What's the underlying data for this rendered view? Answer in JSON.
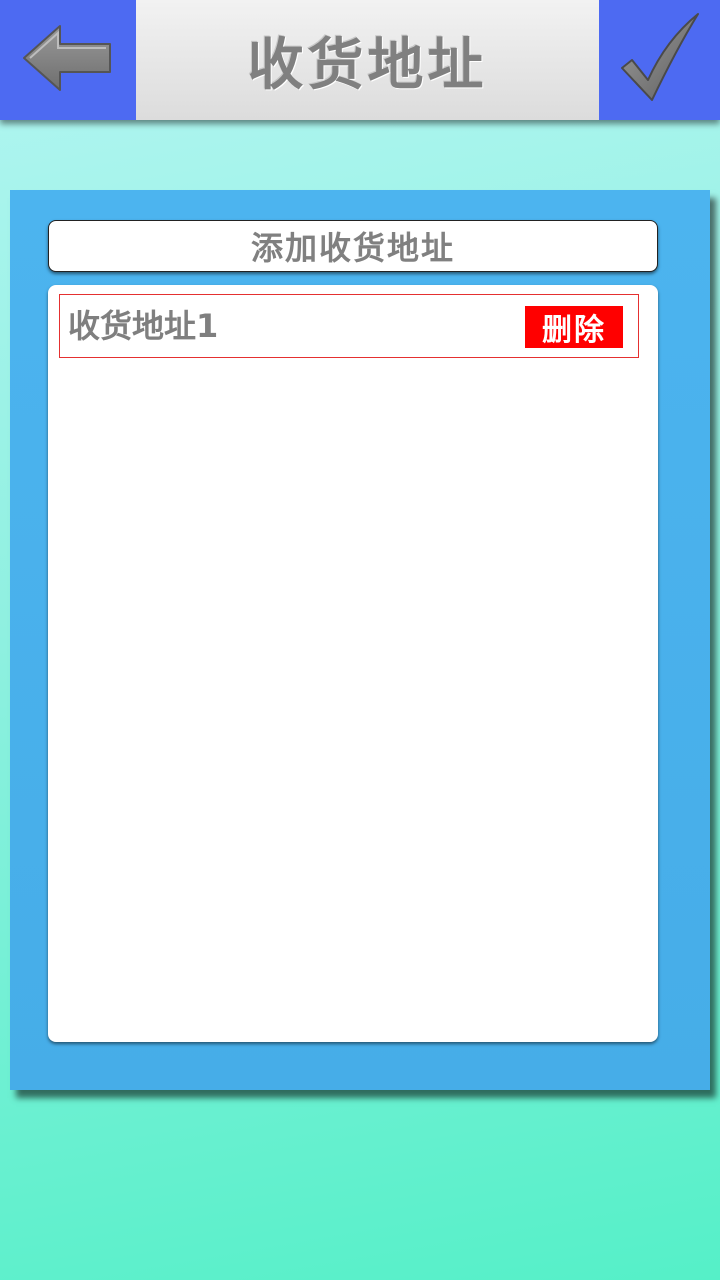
{
  "header": {
    "title": "收货地址",
    "back_icon": "back-arrow-icon",
    "confirm_icon": "checkmark-icon",
    "bar_color": "#4d6af2"
  },
  "panel": {
    "add_button_label": "添加收货地址",
    "addresses": [
      {
        "label": "收货地址1",
        "delete_label": "删除"
      }
    ],
    "accent_color": "#ff0000",
    "panel_color": "#4cb4ef"
  }
}
